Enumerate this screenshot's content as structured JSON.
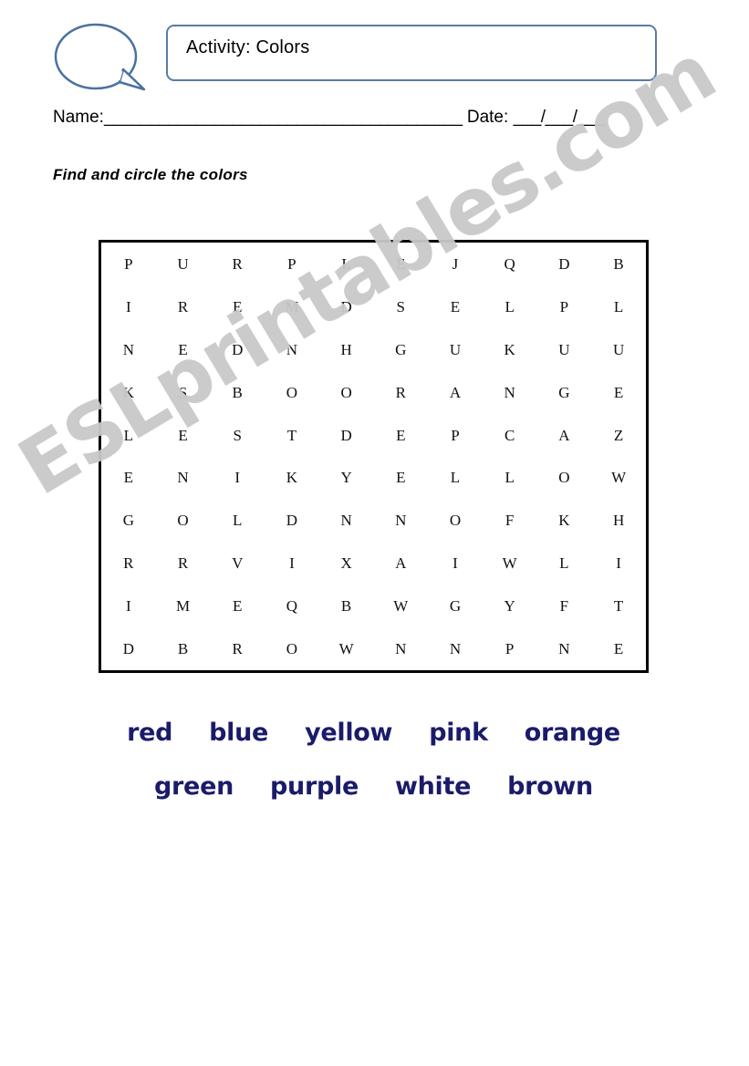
{
  "header": {
    "bubble_icon": "speech-bubble-icon",
    "title": "Activity: Colors",
    "title_border_color": "#5a7ca4"
  },
  "name_date_line": {
    "name_label": "Name:",
    "name_rule": "_______________________________________",
    "date_label": "Date:",
    "date_rule": "___/___/___"
  },
  "instruction": "Find and circle the colors",
  "puzzle": {
    "rows": 10,
    "cols": 10,
    "border_color": "#000000",
    "letters": [
      [
        "P",
        "U",
        "R",
        "P",
        "L",
        "E",
        "J",
        "Q",
        "D",
        "B"
      ],
      [
        "I",
        "R",
        "E",
        "M",
        "D",
        "S",
        "E",
        "L",
        "P",
        "L"
      ],
      [
        "N",
        "E",
        "D",
        "N",
        "H",
        "G",
        "U",
        "K",
        "U",
        "U"
      ],
      [
        "K",
        "S",
        "B",
        "O",
        "O",
        "R",
        "A",
        "N",
        "G",
        "E"
      ],
      [
        "L",
        "E",
        "S",
        "T",
        "D",
        "E",
        "P",
        "C",
        "A",
        "Z"
      ],
      [
        "E",
        "N",
        "I",
        "K",
        "Y",
        "E",
        "L",
        "L",
        "O",
        "W"
      ],
      [
        "G",
        "O",
        "L",
        "D",
        "N",
        "N",
        "O",
        "F",
        "K",
        "H"
      ],
      [
        "R",
        "R",
        "V",
        "I",
        "X",
        "A",
        "I",
        "W",
        "L",
        "I"
      ],
      [
        "I",
        "M",
        "E",
        "Q",
        "B",
        "W",
        "G",
        "Y",
        "F",
        "T"
      ],
      [
        "D",
        "B",
        "R",
        "O",
        "W",
        "N",
        "N",
        "P",
        "N",
        "E"
      ]
    ]
  },
  "word_list": {
    "color": "#1b1b6b",
    "row1": [
      "red",
      "blue",
      "yellow",
      "pink",
      "orange"
    ],
    "row2": [
      "green",
      "purple",
      "white",
      "brown"
    ]
  },
  "watermark": {
    "text": "ESLprintables.com",
    "color": "#c9c9c9"
  }
}
